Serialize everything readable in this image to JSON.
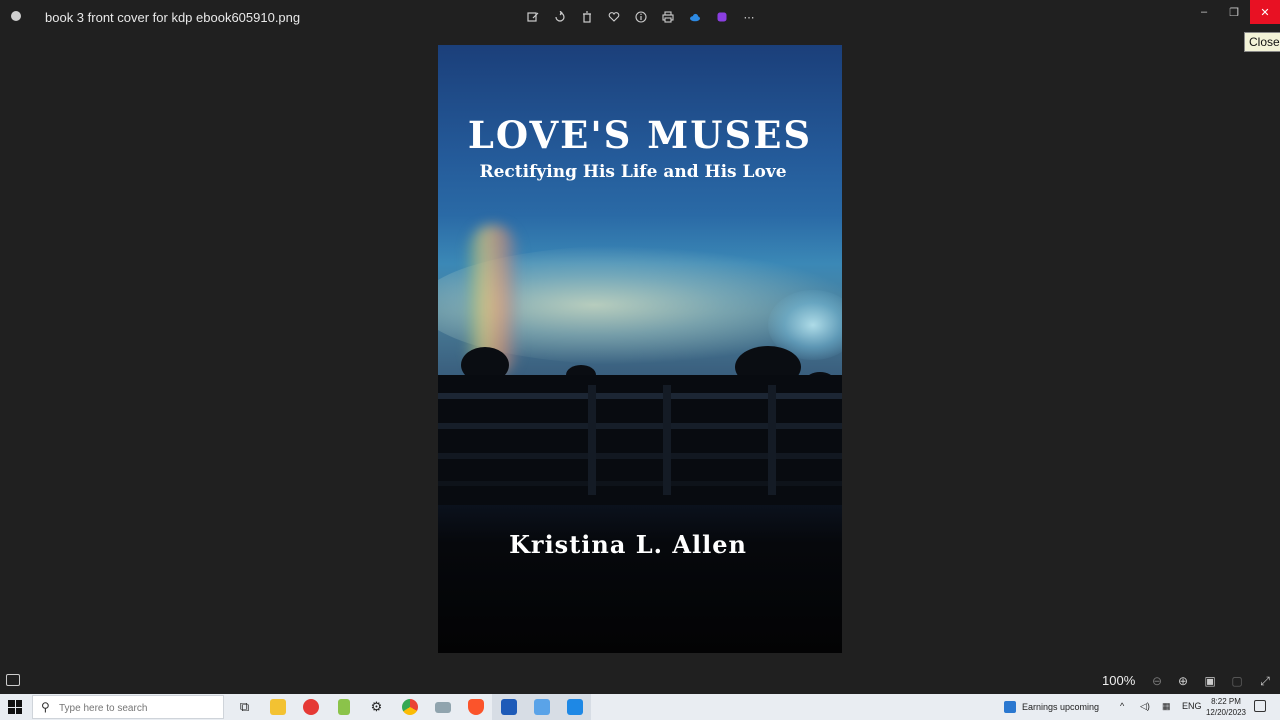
{
  "window": {
    "title": "book 3 front cover for kdp ebook605910.png",
    "tooltip": "Close"
  },
  "toolbar": {
    "buttons": [
      {
        "name": "edit-image-icon"
      },
      {
        "name": "rotate-icon"
      },
      {
        "name": "delete-icon"
      },
      {
        "name": "favorite-icon"
      },
      {
        "name": "info-icon"
      },
      {
        "name": "print-icon"
      },
      {
        "name": "onedrive-icon"
      },
      {
        "name": "clipchamp-icon"
      },
      {
        "name": "more-options-icon"
      }
    ]
  },
  "image": {
    "cover_title": "LOVE'S  MUSES",
    "cover_subtitle": "Rectifying His Life and His Love",
    "cover_author": "Kristina  L.  Allen"
  },
  "statusbar": {
    "zoom": "100%"
  },
  "taskbar": {
    "search_placeholder": "Type here to search",
    "news_text": "Earnings upcoming",
    "language": "ENG",
    "time": "8:22 PM",
    "date": "12/20/2023",
    "colors": {
      "taskbar_bg": "#e9edf2",
      "close_red": "#e81123"
    }
  }
}
